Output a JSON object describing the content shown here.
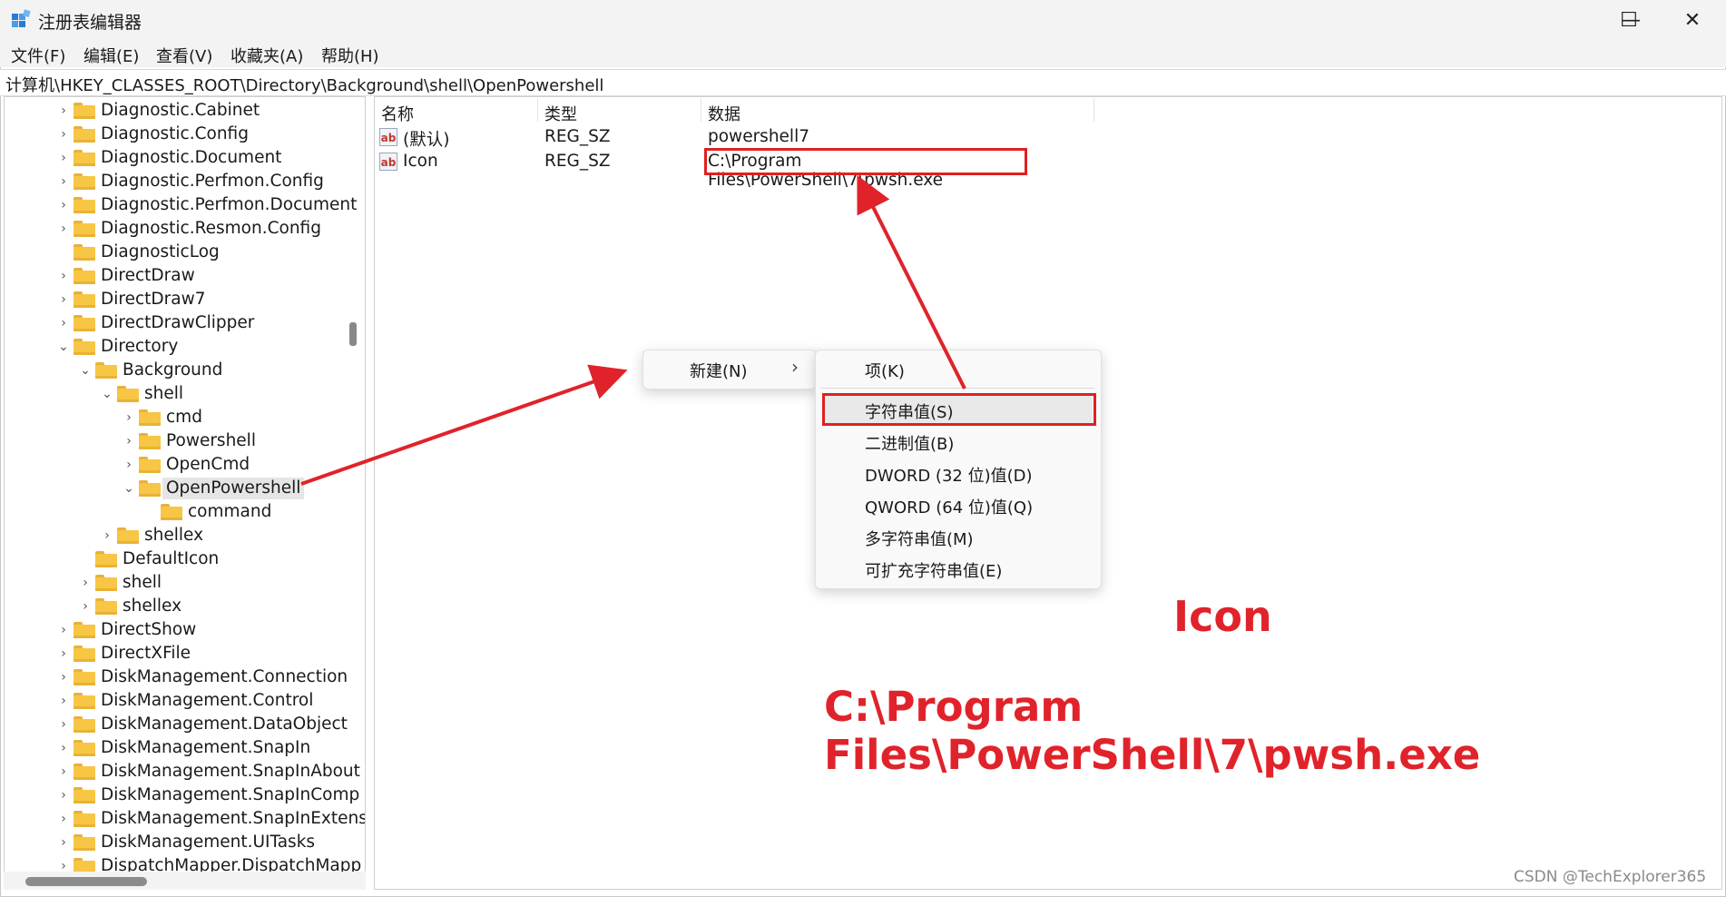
{
  "window": {
    "title": "注册表编辑器",
    "controls": {
      "minimize": "—",
      "maximize": "☐",
      "close": "✕"
    }
  },
  "menu": [
    "文件(F)",
    "编辑(E)",
    "查看(V)",
    "收藏夹(A)",
    "帮助(H)"
  ],
  "address": "计算机\\HKEY_CLASSES_ROOT\\Directory\\Background\\shell\\OpenPowershell",
  "tree": [
    {
      "label": "Diagnostic.Cabinet",
      "level": 0,
      "expander": "right"
    },
    {
      "label": "Diagnostic.Config",
      "level": 0,
      "expander": "right"
    },
    {
      "label": "Diagnostic.Document",
      "level": 0,
      "expander": "right"
    },
    {
      "label": "Diagnostic.Perfmon.Config",
      "level": 0,
      "expander": "right"
    },
    {
      "label": "Diagnostic.Perfmon.Document",
      "level": 0,
      "expander": "right"
    },
    {
      "label": "Diagnostic.Resmon.Config",
      "level": 0,
      "expander": "right"
    },
    {
      "label": "DiagnosticLog",
      "level": 0,
      "expander": "none"
    },
    {
      "label": "DirectDraw",
      "level": 0,
      "expander": "right"
    },
    {
      "label": "DirectDraw7",
      "level": 0,
      "expander": "right"
    },
    {
      "label": "DirectDrawClipper",
      "level": 0,
      "expander": "right"
    },
    {
      "label": "Directory",
      "level": 0,
      "expander": "down"
    },
    {
      "label": "Background",
      "level": 1,
      "expander": "down"
    },
    {
      "label": "shell",
      "level": 2,
      "expander": "down"
    },
    {
      "label": "cmd",
      "level": 3,
      "expander": "right"
    },
    {
      "label": "Powershell",
      "level": 3,
      "expander": "right"
    },
    {
      "label": "OpenCmd",
      "level": 3,
      "expander": "right"
    },
    {
      "label": "OpenPowershell",
      "level": 3,
      "expander": "down",
      "selected": true
    },
    {
      "label": "command",
      "level": 4,
      "expander": "none"
    },
    {
      "label": "shellex",
      "level": 2,
      "expander": "right"
    },
    {
      "label": "DefaultIcon",
      "level": 1,
      "expander": "none"
    },
    {
      "label": "shell",
      "level": 1,
      "expander": "right"
    },
    {
      "label": "shellex",
      "level": 1,
      "expander": "right"
    },
    {
      "label": "DirectShow",
      "level": 0,
      "expander": "right"
    },
    {
      "label": "DirectXFile",
      "level": 0,
      "expander": "right"
    },
    {
      "label": "DiskManagement.Connection",
      "level": 0,
      "expander": "right"
    },
    {
      "label": "DiskManagement.Control",
      "level": 0,
      "expander": "right"
    },
    {
      "label": "DiskManagement.DataObject",
      "level": 0,
      "expander": "right"
    },
    {
      "label": "DiskManagement.SnapIn",
      "level": 0,
      "expander": "right"
    },
    {
      "label": "DiskManagement.SnapInAbout",
      "level": 0,
      "expander": "right"
    },
    {
      "label": "DiskManagement.SnapInComp",
      "level": 0,
      "expander": "right"
    },
    {
      "label": "DiskManagement.SnapInExtens",
      "level": 0,
      "expander": "right"
    },
    {
      "label": "DiskManagement.UITasks",
      "level": 0,
      "expander": "right"
    },
    {
      "label": "DispatchMapper.DispatchMapp",
      "level": 0,
      "expander": "right"
    }
  ],
  "list": {
    "columns": [
      "名称",
      "类型",
      "数据"
    ],
    "rows": [
      {
        "name": "(默认)",
        "type": "REG_SZ",
        "data": "powershell7"
      },
      {
        "name": "Icon",
        "type": "REG_SZ",
        "data": "C:\\Program Files\\PowerShell\\7\\pwsh.exe"
      }
    ]
  },
  "context_menu": {
    "new_label": "新建(N)",
    "chevron": "›",
    "submenu": [
      "项(K)",
      "字符串值(S)",
      "二进制值(B)",
      "DWORD (32 位)值(D)",
      "QWORD (64 位)值(Q)",
      "多字符串值(M)",
      "可扩充字符串值(E)"
    ]
  },
  "annotations": {
    "icon_label": "Icon",
    "path_label": "C:\\Program Files\\PowerShell\\7\\pwsh.exe",
    "color": "#e0232b"
  },
  "watermark": "CSDN @TechExplorer365",
  "icons": {
    "value_icon": "ab",
    "folder": "folder-icon"
  }
}
